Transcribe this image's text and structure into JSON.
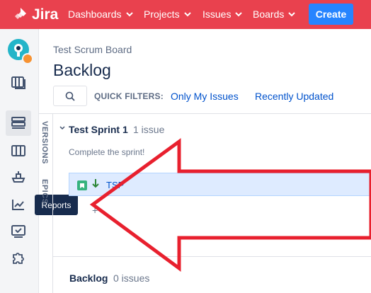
{
  "topnav": {
    "logo_text": "Jira",
    "items": [
      {
        "label": "Dashboards"
      },
      {
        "label": "Projects"
      },
      {
        "label": "Issues"
      },
      {
        "label": "Boards"
      }
    ],
    "create_label": "Create",
    "colors": {
      "bar": "#E9414E",
      "create": "#2684FF"
    }
  },
  "sidebar": {
    "icons": [
      "avatar",
      "backlog-board-icon",
      "backlog-icon",
      "board-columns-icon",
      "releases-icon",
      "reports-icon",
      "issues-icon",
      "add-ons-icon"
    ],
    "tooltip": "Reports"
  },
  "main": {
    "breadcrumb": "Test Scrum Board",
    "title": "Backlog",
    "quick_filters_label": "QUICK FILTERS:",
    "quick_filters": [
      {
        "label": "Only My Issues"
      },
      {
        "label": "Recently Updated"
      }
    ],
    "vertical_tabs": [
      "VERSIONS",
      "EPICS"
    ],
    "sprint": {
      "name": "Test Sprint 1",
      "count": "1 issue",
      "goal": "Complete the sprint!",
      "issue_key": "TSP"
    },
    "add_symbol": "+",
    "backlog": {
      "name": "Backlog",
      "count": "0 issues"
    }
  },
  "overlay": {
    "annotation": "red-arrow",
    "color": "#E8202E"
  }
}
